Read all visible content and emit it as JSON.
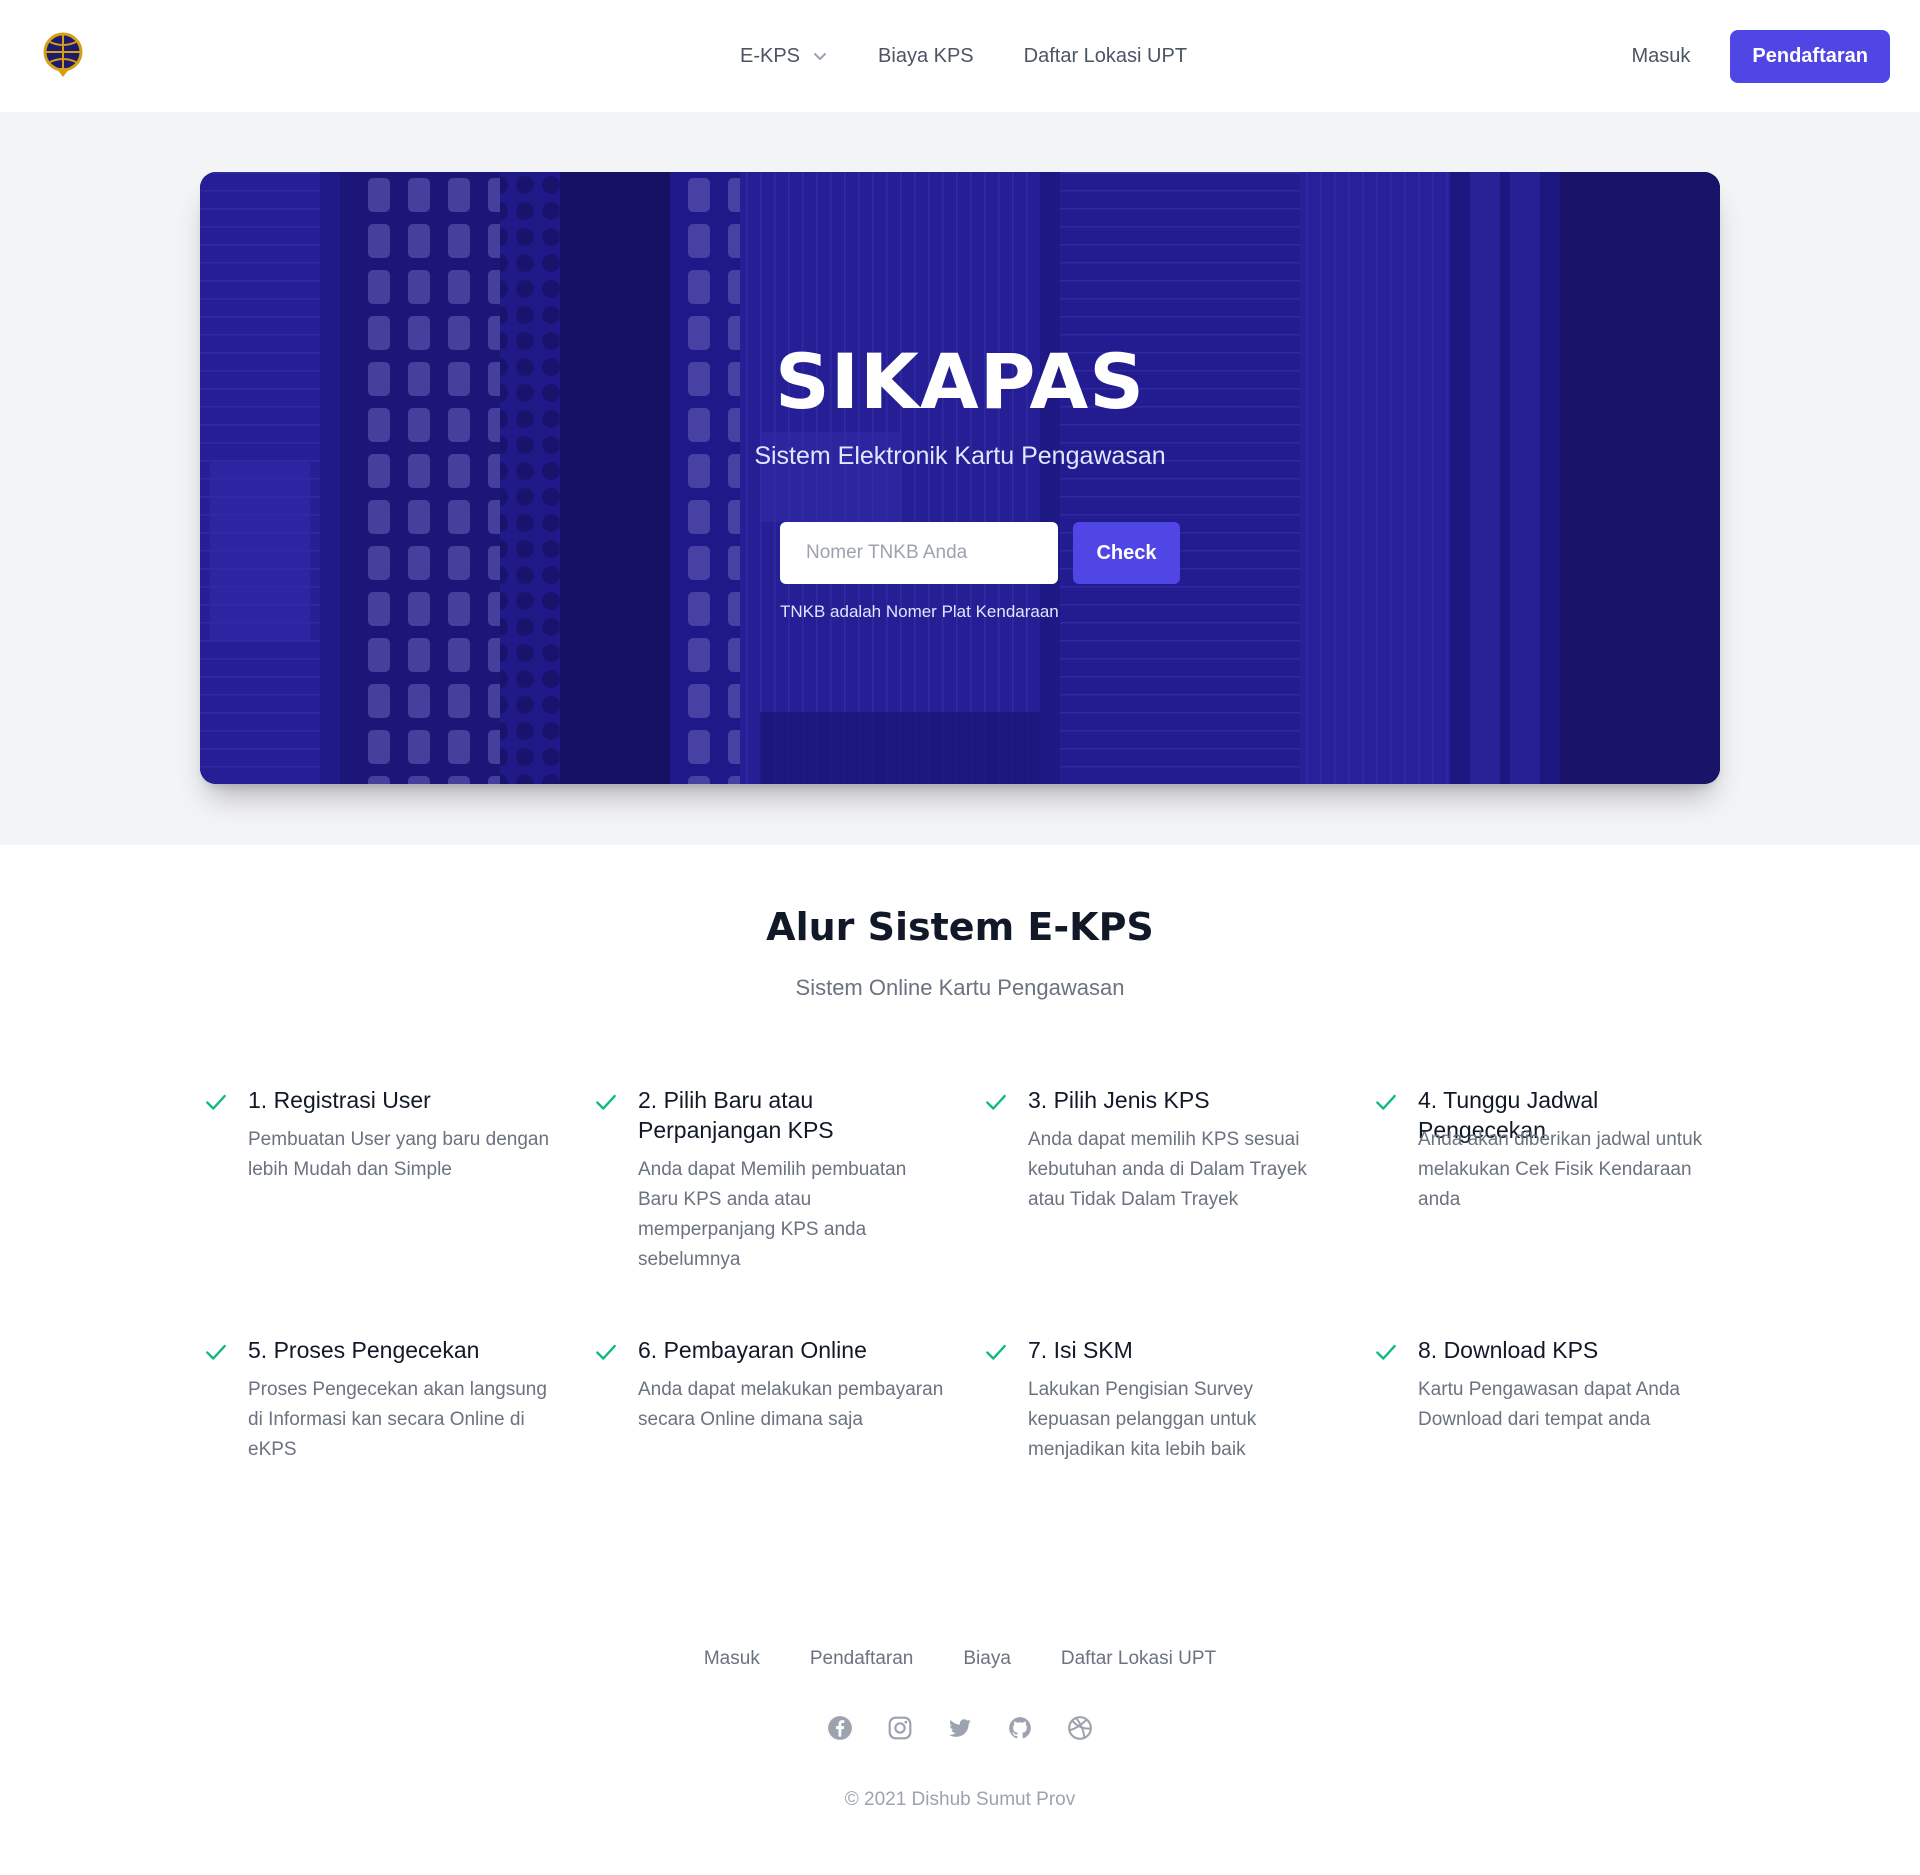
{
  "nav": {
    "logo_icon": "dishub-logo-icon",
    "links": [
      {
        "label": "E-KPS",
        "has_dropdown": true
      },
      {
        "label": "Biaya KPS"
      },
      {
        "label": "Daftar Lokasi UPT"
      }
    ],
    "login_label": "Masuk",
    "register_label": "Pendaftaran"
  },
  "hero": {
    "title": "SIKAPAS",
    "subtitle": "Sistem Elektronik Kartu Pengawasan",
    "search_placeholder": "Nomer TNKB Anda",
    "search_value": "",
    "check_label": "Check",
    "hint": "TNKB adalah Nomer Plat Kendaraan"
  },
  "steps_section": {
    "title": "Alur Sistem E-KPS",
    "subtitle": "Sistem Online Kartu Pengawasan",
    "steps": [
      {
        "title": "1. Registrasi User",
        "desc": "Pembuatan User yang baru dengan lebih Mudah dan Simple"
      },
      {
        "title": "2. Pilih Baru atau Perpanjangan KPS",
        "desc": "Anda dapat Memilih pembuatan Baru KPS anda atau memperpanjang KPS anda sebelumnya"
      },
      {
        "title": "3. Pilih Jenis KPS",
        "desc": "Anda dapat memilih KPS sesuai kebutuhan anda di Dalam Trayek atau Tidak Dalam Trayek"
      },
      {
        "title": "4. Tunggu Jadwal Pengecekan",
        "desc": "Anda akan diberikan jadwal untuk melakukan Cek Fisik Kendaraan anda"
      },
      {
        "title": "5. Proses Pengecekan",
        "desc": "Proses Pengecekan akan langsung di Informasi kan secara Online di eKPS"
      },
      {
        "title": "6. Pembayaran Online",
        "desc": "Anda dapat melakukan pembayaran secara Online dimana saja"
      },
      {
        "title": "7. Isi SKM",
        "desc": "Lakukan Pengisian Survey kepuasan pelanggan untuk menjadikan kita lebih baik"
      },
      {
        "title": "8. Download KPS",
        "desc": "Kartu Pengawasan dapat Anda Download dari tempat anda"
      }
    ]
  },
  "footer": {
    "links": [
      "Masuk",
      "Pendaftaran",
      "Biaya",
      "Daftar Lokasi UPT"
    ],
    "socials": [
      "facebook-icon",
      "instagram-icon",
      "twitter-icon",
      "github-icon",
      "dribbble-icon"
    ],
    "copyright": "© 2021 Dishub Sumut Prov"
  },
  "colors": {
    "accent": "#4f46e5",
    "check": "#10b981",
    "hero_tint": "#2a22a8"
  }
}
